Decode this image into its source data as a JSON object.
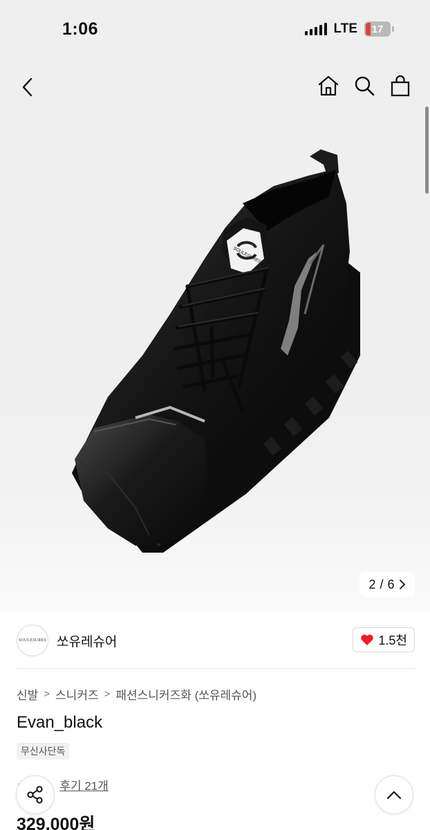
{
  "status_bar": {
    "time": "1:06",
    "network": "LTE",
    "battery": "17",
    "battery_color": "#e0413a"
  },
  "hero": {
    "nav": {
      "back_icon": "chevron-left-icon",
      "home_icon": "home-icon",
      "search_icon": "search-icon",
      "bag_icon": "shopping-bag-icon"
    },
    "image": "black square-toe lace-up sneaker",
    "shoe_tab_text": "SOULESURES",
    "pager": {
      "current": "2",
      "separator": "/",
      "total": "6"
    }
  },
  "brand": {
    "logo_text": "SOULESURES",
    "name": "쏘유레슈어",
    "likes": "1.5천",
    "like_color": "#e5202f"
  },
  "breadcrumb": [
    "신발",
    "스니커즈",
    "패션스니커즈화 (쏘유레슈어)"
  ],
  "product": {
    "title": "Evan_black",
    "badge": "무신사단독",
    "review_label": "후기 21개",
    "price": "329,000원"
  },
  "floating": {
    "share_icon": "share-icon",
    "top_icon": "chevron-up-icon"
  }
}
